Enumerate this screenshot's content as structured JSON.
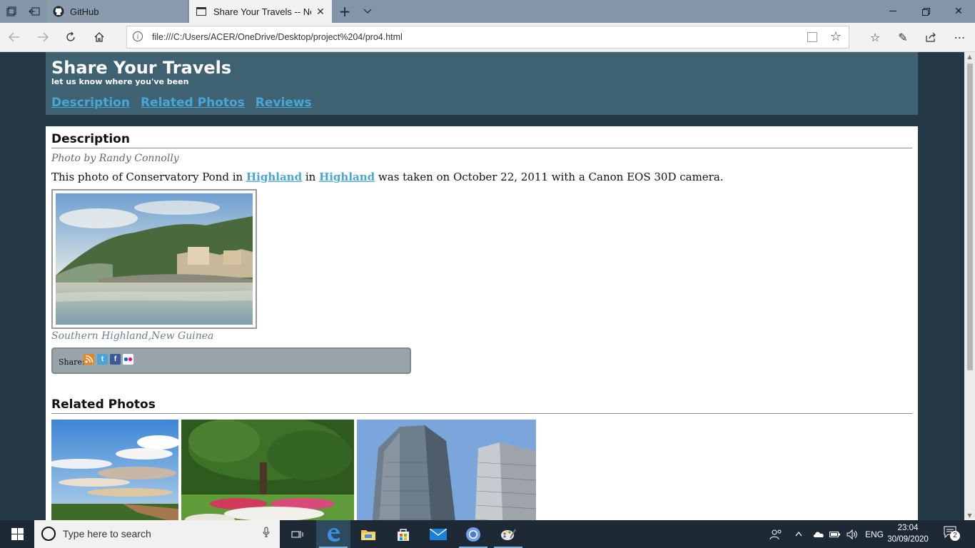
{
  "browser": {
    "tabs": [
      {
        "label": "GitHub",
        "active": false
      },
      {
        "label": "Share Your Travels -- Ne",
        "active": true
      }
    ],
    "url": "file:///C:/Users/ACER/OneDrive/Desktop/project%204/pro4.html"
  },
  "site": {
    "title": "Share Your Travels",
    "tagline": "let us know where you've been",
    "nav": [
      "Description",
      "Related Photos",
      "Reviews"
    ]
  },
  "description": {
    "heading": "Description",
    "credit": "Photo by Randy Connolly",
    "sentence": {
      "part1": "This photo of Conservatory Pond in ",
      "link1": "Highland",
      "part2": " in ",
      "link2": "Highland",
      "part3": " was taken on October 22, 2011 with a Canon EOS 30D camera."
    },
    "caption": "Southern Highland,New Guinea",
    "share_label": "Share:",
    "share_icons": [
      "rss-icon",
      "twitter-icon",
      "facebook-icon",
      "flickr-icon"
    ]
  },
  "related": {
    "heading": "Related Photos"
  },
  "taskbar": {
    "search_placeholder": "Type here to search",
    "language": "ENG",
    "time": "23:04",
    "date": "30/09/2020",
    "notification_count": "2"
  },
  "colors": {
    "header_bg": "#3e6271",
    "link": "#47a6d8",
    "page_bg": "#243845"
  }
}
